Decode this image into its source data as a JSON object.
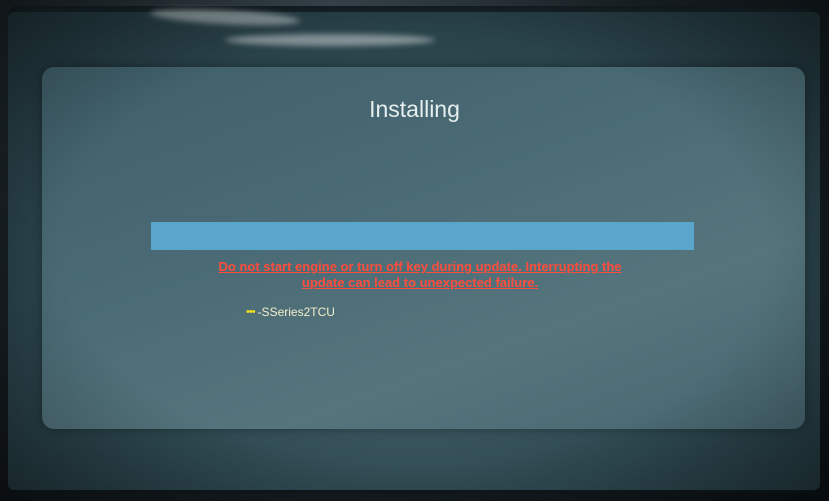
{
  "dialog": {
    "title": "Installing",
    "progress": 1.0,
    "warning_line1": "Do not start engine or turn off key during update. Interrupting the",
    "warning_line2": "update can lead to unexpected failure.",
    "status_indicator": "•••",
    "status_text": "-SSeries2TCU"
  },
  "colors": {
    "progress_fill": "#5aa5cb",
    "warning": "#ff4d3d",
    "status_dots": "#f0e020",
    "title": "#e6eeee"
  }
}
